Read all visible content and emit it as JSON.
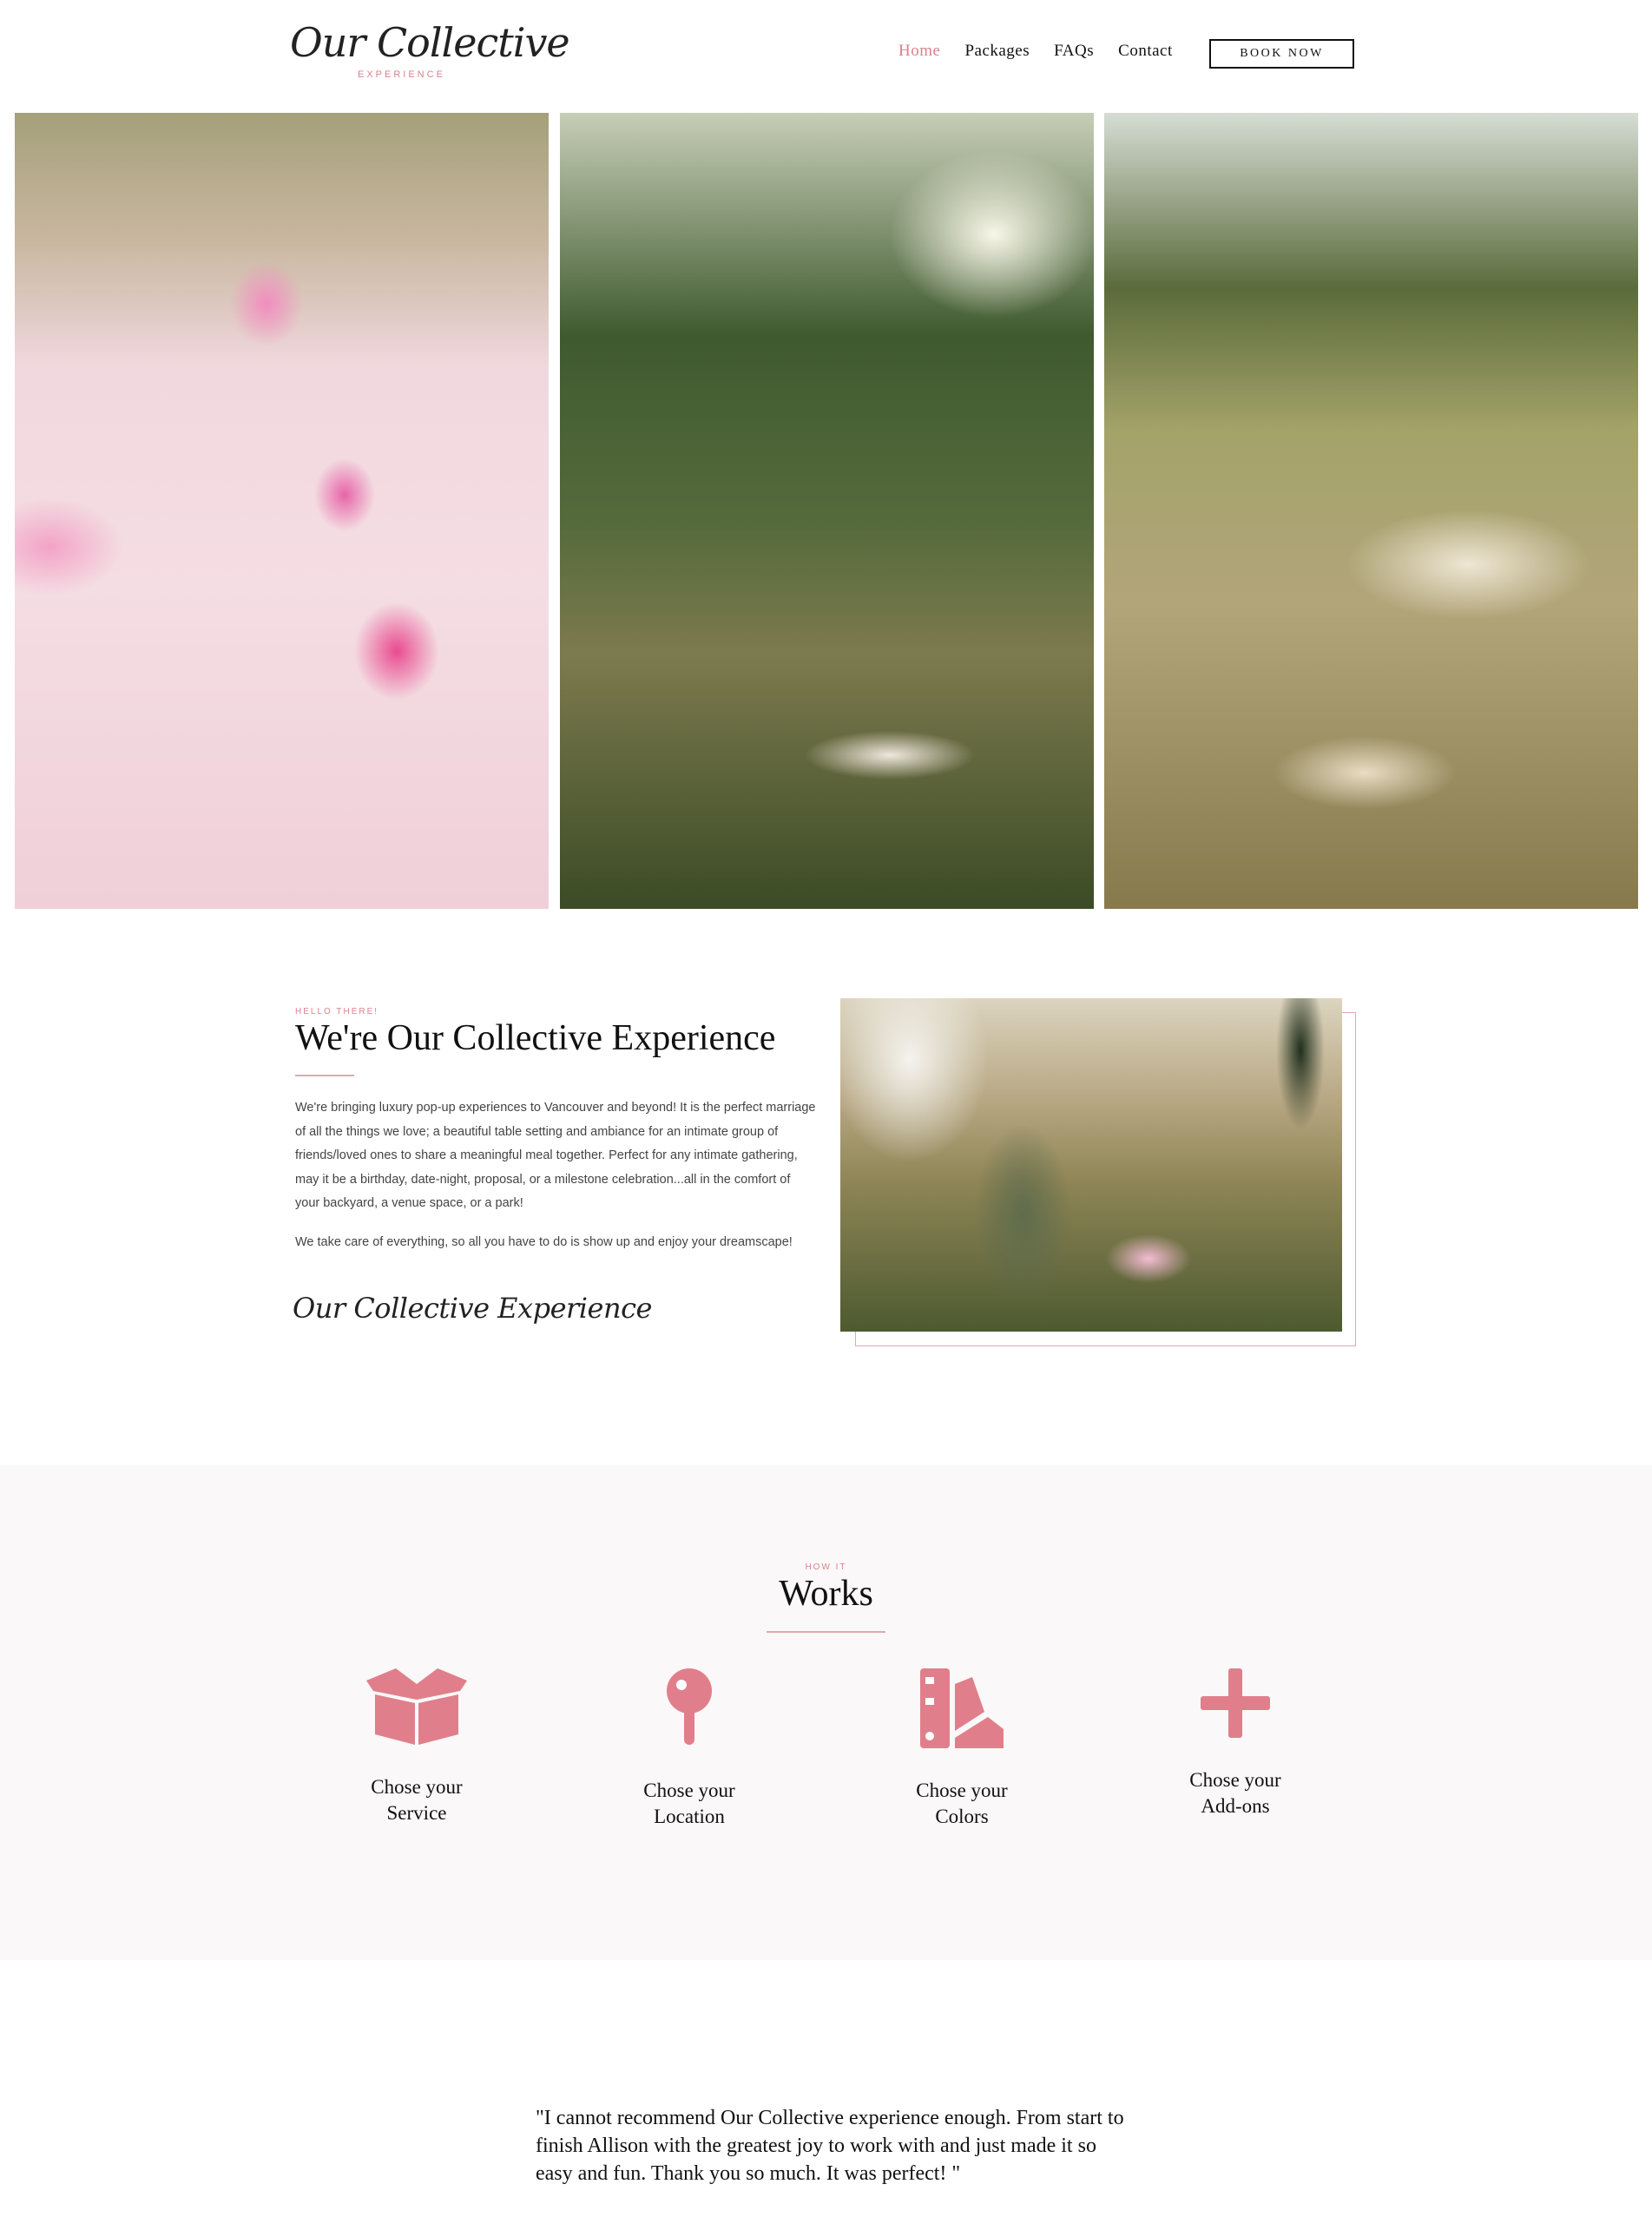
{
  "header": {
    "logo_script": "Our Collective",
    "logo_sub": "EXPERIENCE",
    "nav": [
      {
        "label": "Home",
        "active": true
      },
      {
        "label": "Packages",
        "active": false
      },
      {
        "label": "FAQs",
        "active": false
      },
      {
        "label": "Contact",
        "active": false
      }
    ],
    "cta": "BOOK NOW"
  },
  "about": {
    "eyebrow": "HELLO THERE!",
    "title": "We're Our Collective Experience",
    "paragraph1": "We're bringing luxury pop-up experiences to Vancouver and beyond! It is the perfect marriage of all the things we love; a beautiful table setting and ambiance for an intimate group of friends/loved ones to share a meaningful meal together. Perfect for any intimate gathering, may it be a birthday, date-night, proposal, or a milestone celebration...all in the comfort of your backyard, a venue space, or a park!",
    "paragraph2": "We take care of everything, so all you have to do is show up and enjoy your dreamscape!",
    "signature": "Our Collective Experience"
  },
  "works": {
    "eyebrow": "HOW IT",
    "title": "Works",
    "steps": [
      {
        "icon": "box-icon",
        "label": "Chose your\nService"
      },
      {
        "icon": "map-pin-icon",
        "label": "Chose your\nLocation"
      },
      {
        "icon": "color-swatch-icon",
        "label": "Chose your\nColors"
      },
      {
        "icon": "plus-icon",
        "label": "Chose your\nAdd-ons"
      }
    ]
  },
  "testimonial": {
    "quote": "\"I cannot recommend Our Collective experience enough. From start to finish Allison with the greatest joy to work with and just made it so easy and fun. Thank you so much. It was perfect! \""
  },
  "colors": {
    "accent": "#d9828d",
    "icon": "#e07f8b",
    "band": "#faf8f8"
  }
}
